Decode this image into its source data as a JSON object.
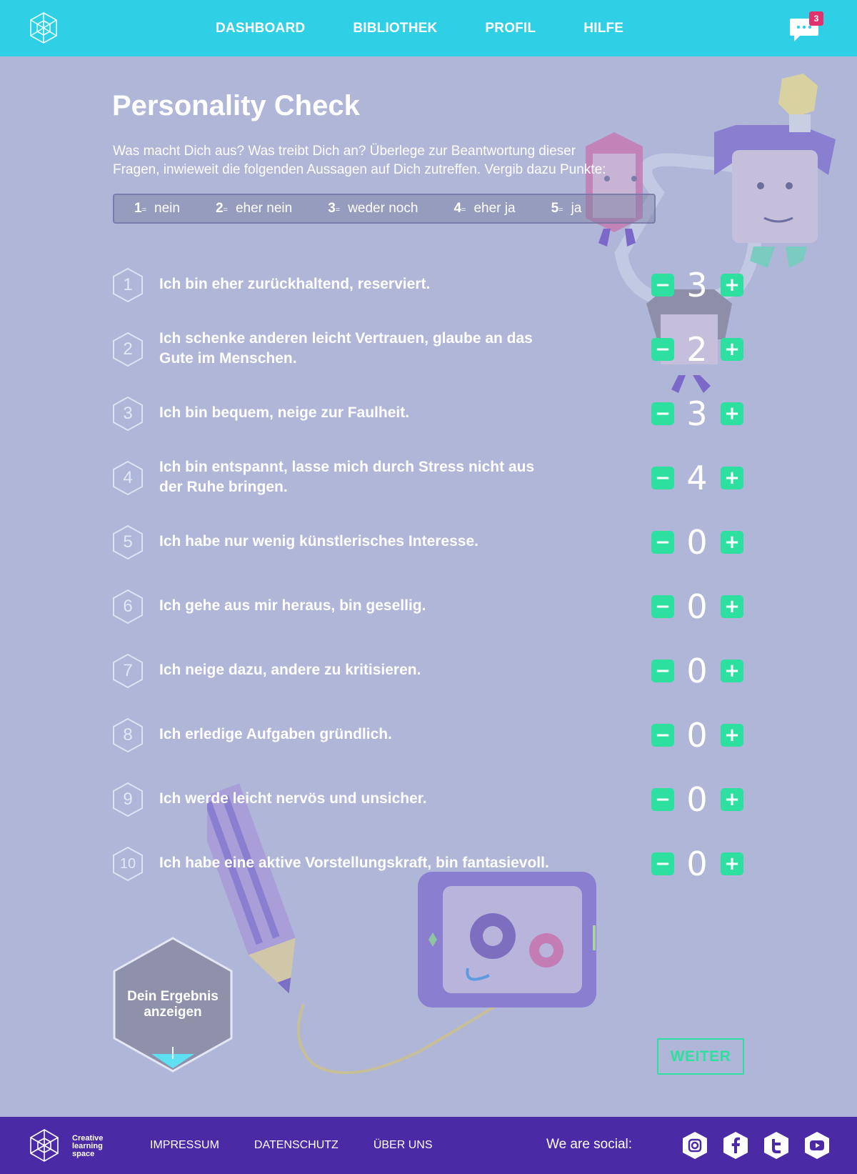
{
  "header": {
    "nav": [
      "DASHBOARD",
      "BIBLIOTHEK",
      "PROFIL",
      "HILFE"
    ],
    "chat_badge": "3",
    "logo_icon": "snowflake-network-logo-icon",
    "chat_icon": "chat-bubble-icon"
  },
  "main": {
    "title": "Personality Check",
    "intro_line1": "Was macht Dich aus? Was treibt Dich an? Überlege zur Beantwortung dieser",
    "intro_line2": "Fragen, inwieweit die folgenden Aussagen auf Dich zutreffen. Vergib dazu Punkte:",
    "scale": [
      {
        "num": "1",
        "eq": "=",
        "label": "nein"
      },
      {
        "num": "2",
        "eq": "=",
        "label": "eher nein"
      },
      {
        "num": "3",
        "eq": "=",
        "label": "weder noch"
      },
      {
        "num": "4",
        "eq": "=",
        "label": "eher ja"
      },
      {
        "num": "5",
        "eq": "=",
        "label": "ja"
      }
    ],
    "questions": [
      {
        "num": "1",
        "text": "Ich bin eher zurückhaltend, reserviert.",
        "value": "3"
      },
      {
        "num": "2",
        "text": "Ich schenke anderen leicht Vertrauen, glaube an das Gute im Menschen.",
        "value": "2"
      },
      {
        "num": "3",
        "text": "Ich bin bequem, neige zur Faulheit.",
        "value": "3"
      },
      {
        "num": "4",
        "text": "Ich bin entspannt, lasse mich durch Stress nicht aus der Ruhe bringen.",
        "value": "4"
      },
      {
        "num": "5",
        "text": "Ich habe nur wenig künstlerisches Interesse.",
        "value": "0"
      },
      {
        "num": "6",
        "text": "Ich gehe aus mir heraus, bin gesellig.",
        "value": "0"
      },
      {
        "num": "7",
        "text": "Ich neige dazu, andere zu kritisieren.",
        "value": "0"
      },
      {
        "num": "8",
        "text": "Ich erledige Aufgaben gründlich.",
        "value": "0"
      },
      {
        "num": "9",
        "text": "Ich werde leicht nervös und unsicher.",
        "value": "0"
      },
      {
        "num": "10",
        "text": "Ich habe eine aktive Vorstellungskraft, bin fantasievoll.",
        "value": "0"
      }
    ],
    "minus_label": "−",
    "plus_label": "+",
    "result_line1": "Dein Ergebnis",
    "result_line2": "anzeigen",
    "weiter_label": "WEITER"
  },
  "footer": {
    "brand": [
      "Creative",
      "learning",
      "space"
    ],
    "links": [
      "IMPRESSUM",
      "DATENSCHUTZ",
      "ÜBER UNS"
    ],
    "social_label": "We are social:",
    "social_icons": [
      "instagram-icon",
      "facebook-icon",
      "twitter-icon",
      "youtube-icon"
    ]
  },
  "colors": {
    "header": "#2fd0e6",
    "background": "#b0b6d8",
    "accent_green": "#2ee0a0",
    "footer": "#4b2aa6",
    "badge": "#e0336e"
  }
}
